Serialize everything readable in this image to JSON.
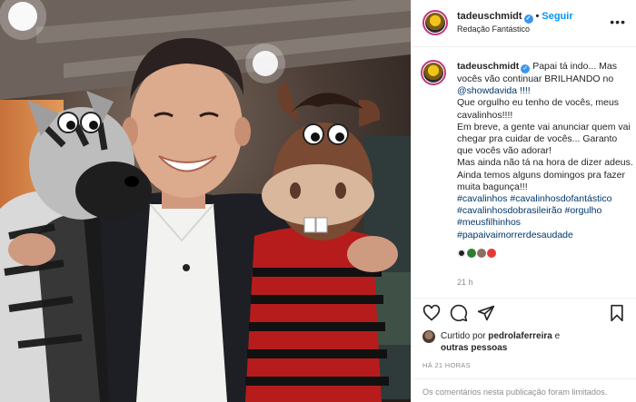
{
  "post": {
    "username": "tadeuschmidt",
    "follow_label": "Seguir",
    "location": "Redação Fantástico",
    "more_icon": "more-dots-icon"
  },
  "caption": {
    "username": "tadeuschmidt",
    "lines": [
      "Papai tá indo... Mas",
      "vocês vão continuar BRILHANDO no",
      "@showdavida !!!!",
      "Que orgulho eu tenho de vocês, meus",
      "cavalinhos!!!!",
      "Em breve, a gente vai anunciar quem vai",
      "chegar pra cuidar de vocês... Garanto",
      "que vocês vão adorar!",
      "Mas ainda não tá na hora de dizer adeus.",
      "Ainda temos alguns domingos pra fazer",
      "muita bagunça!!!",
      "#cavalinhos #cavalinhosdofantástico",
      "#cavalinhosdobrasileirão #orgulho",
      "#meusfilhinhos",
      "#papaivaimorrerdesaudade"
    ],
    "emoji_colors": [
      "#222222",
      "#2e7d32",
      "#8d6e63",
      "#e53935"
    ],
    "time": "21 h"
  },
  "actions": {
    "like_icon": "heart-icon",
    "comment_icon": "comment-icon",
    "share_icon": "share-icon",
    "save_icon": "bookmark-icon"
  },
  "likes": {
    "prefix": "Curtido por",
    "user": "pedrolaferreira",
    "joiner": "e",
    "others": "outras pessoas"
  },
  "timestamp": "HÁ 21 HORAS",
  "comments_limited": "Os comentários nesta publicação foram limitados.",
  "colors": {
    "link": "#00376b",
    "follow": "#0095f6",
    "muted": "#8e8e8e",
    "verified": "#3897f0"
  }
}
